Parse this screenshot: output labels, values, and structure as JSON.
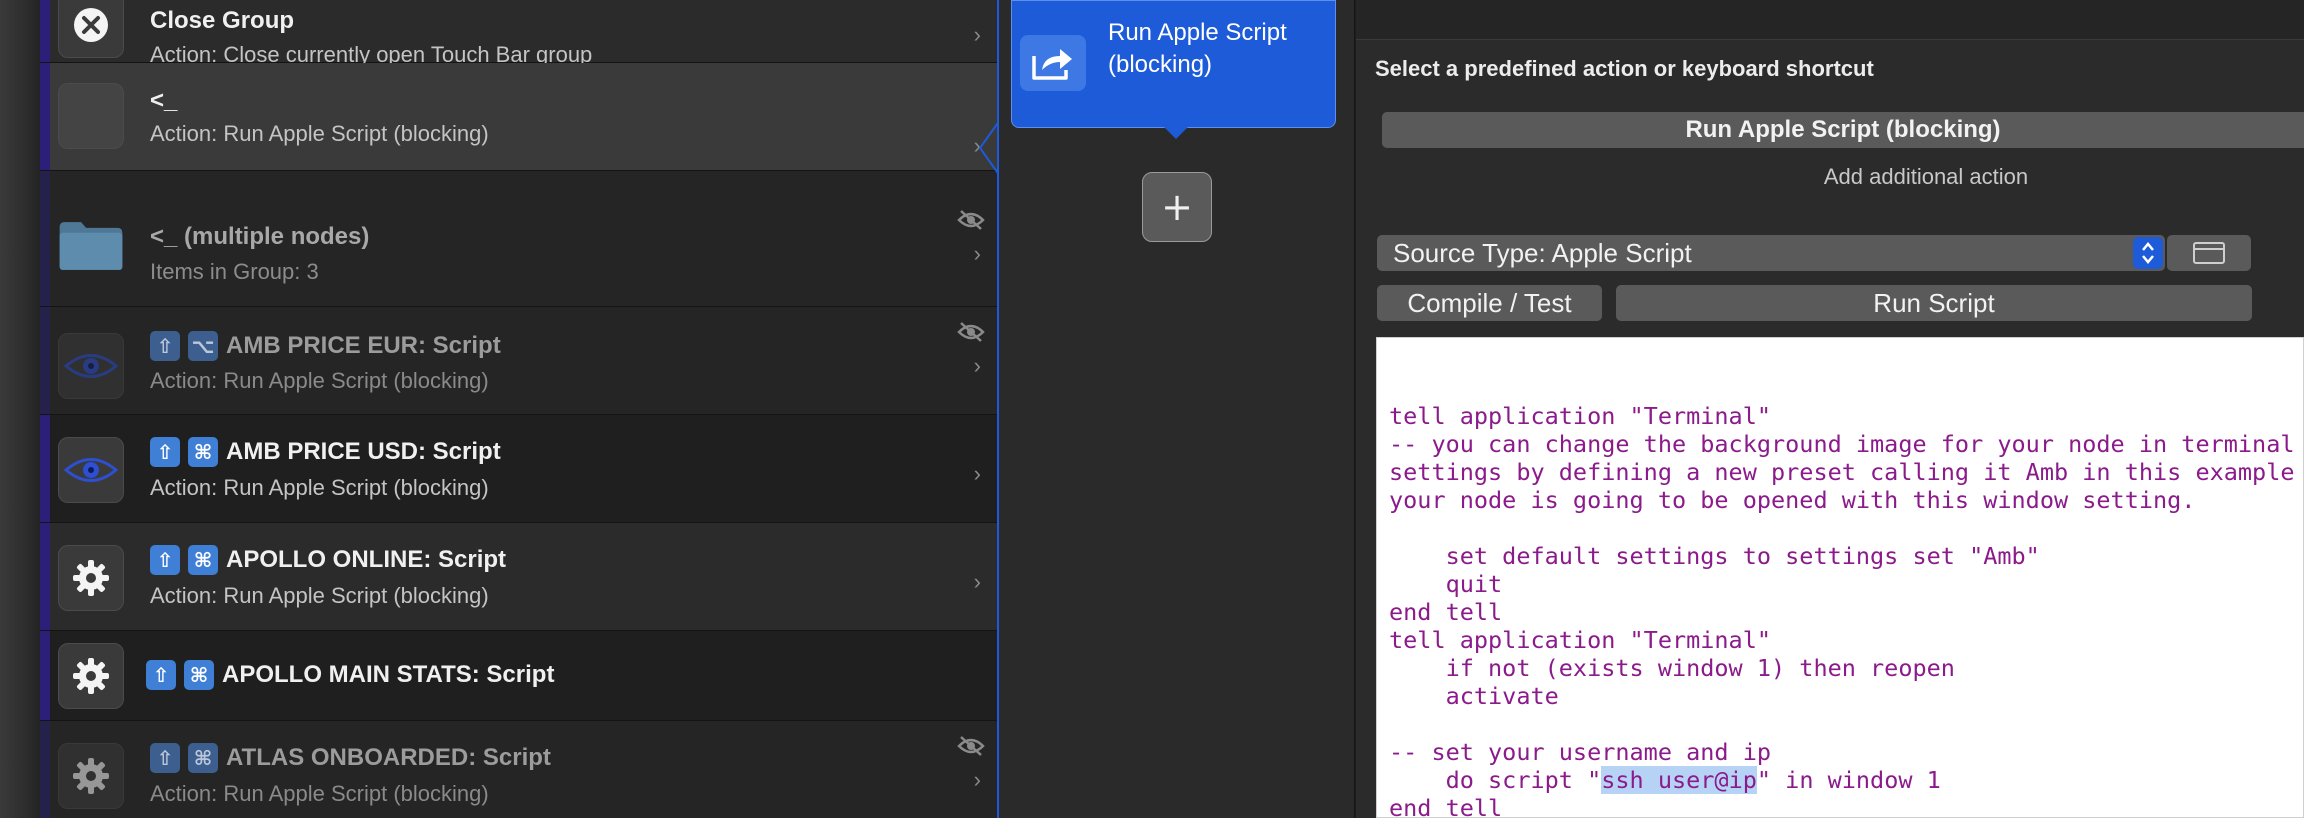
{
  "node_list": {
    "rows": [
      {
        "title": "Close Group",
        "subtitle": "Action: Close currently open Touch Bar group",
        "icon": "close-circle-icon"
      },
      {
        "title": "<_",
        "subtitle": "Action: Run Apple Script (blocking)",
        "icon": "empty-icon"
      },
      {
        "title": "<_ (multiple nodes)",
        "subtitle": "Items in Group: 3",
        "icon": "folder-icon",
        "hidden": true
      },
      {
        "title": "AMB PRICE EUR: Script",
        "subtitle": "Action: Run Apple Script (blocking)",
        "icon": "eye-icon",
        "hidden": true,
        "shortcut": [
          "⇧",
          "⌥"
        ]
      },
      {
        "title": "AMB PRICE USD: Script",
        "subtitle": "Action: Run Apple Script (blocking)",
        "icon": "eye-icon",
        "shortcut": [
          "⇧",
          "⌘"
        ]
      },
      {
        "title": "APOLLO ONLINE: Script",
        "subtitle": "Action: Run Apple Script (blocking)",
        "icon": "gear-icon",
        "shortcut": [
          "⇧",
          "⌘"
        ]
      },
      {
        "title": "APOLLO MAIN STATS: Script",
        "subtitle": "",
        "icon": "gear-icon",
        "shortcut": [
          "⇧",
          "⌘"
        ]
      },
      {
        "title": "ATLAS ONBOARDED: Script",
        "subtitle": "Action: Run Apple Script (blocking)",
        "icon": "gear-icon",
        "hidden": true,
        "shortcut": [
          "⇧",
          "⌘"
        ]
      }
    ],
    "chevron": "›"
  },
  "action_column": {
    "card_label": "Run Apple Script (blocking)",
    "add_label": "+"
  },
  "inspector": {
    "section_title": "Select a predefined action or keyboard shortcut",
    "selected_action": "Run Apple Script (blocking)",
    "add_additional_action": "Add additional action",
    "source_type": "Source Type: Apple Script",
    "compile_label": "Compile / Test",
    "run_label": "Run Script",
    "code_lines": [
      "tell application \"Terminal\"",
      "-- you can change the background image for your node in terminal",
      "settings by defining a new preset calling it Amb in this example",
      "your node is going to be opened with this window setting.",
      "",
      "    set default settings to settings set \"Amb\"",
      "    quit",
      "end tell",
      "tell application \"Terminal\"",
      "    if not (exists window 1) then reopen",
      "    activate",
      "",
      "-- set your username and ip",
      "    do script \"ssh user@ip\" in window 1",
      "end tell"
    ],
    "highlighted_text": "ssh user@ip"
  },
  "colors": {
    "accent_blue": "#1d5bd8",
    "code_purple": "#8b1a8b",
    "row_accent": "#2b1f7a",
    "background": "#1e1e1e"
  }
}
